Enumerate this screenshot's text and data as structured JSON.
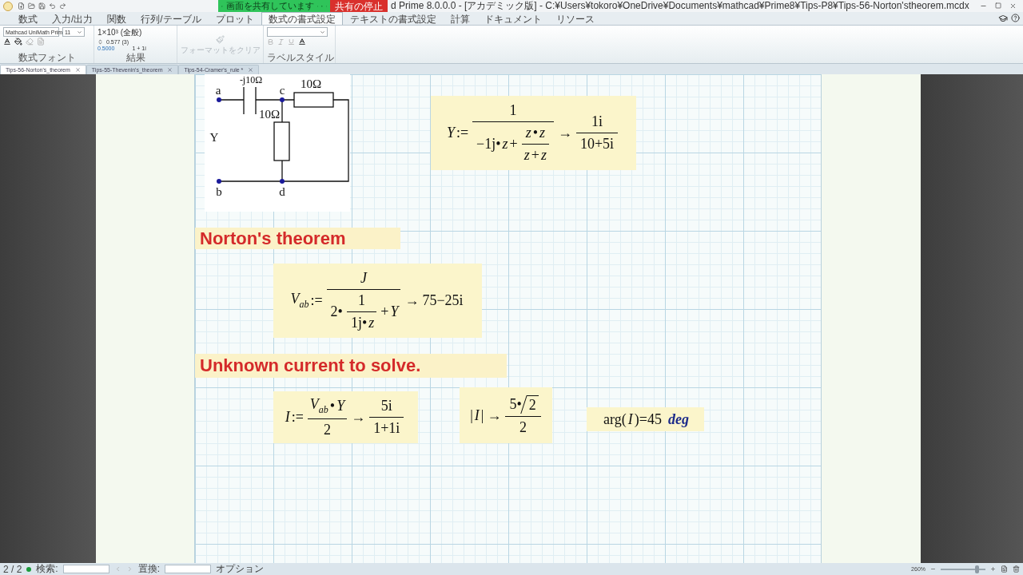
{
  "title_bar": {
    "share_banner": "画面を共有しています",
    "stop_button": "共有の停止",
    "title": "d Prime 8.0.0.0 - [アカデミック版] - C:¥Users¥tokoro¥OneDrive¥Documents¥mathcad¥Prime8¥Tips-P8¥Tips-56-Norton'stheorem.mcdx"
  },
  "ribbon_tabs": [
    {
      "label": "数式",
      "selected": false
    },
    {
      "label": "入力/出力",
      "selected": false
    },
    {
      "label": "関数",
      "selected": false
    },
    {
      "label": "行列/テーブル",
      "selected": false
    },
    {
      "label": "プロット",
      "selected": false
    },
    {
      "label": "数式の書式設定",
      "selected": true
    },
    {
      "label": "テキストの書式設定",
      "selected": false
    },
    {
      "label": "計算",
      "selected": false
    },
    {
      "label": "ドキュメント",
      "selected": false
    },
    {
      "label": "リソース",
      "selected": false
    }
  ],
  "ribbon": {
    "font": "Mathcad UniMath Prim",
    "size": "11",
    "format": "1×10³ (全般)",
    "precision": "0.577 (3)",
    "threshold": "0.5000",
    "complex": "1 + 1i",
    "clear_format": {
      "label": "フォーマットをクリア",
      "disabled": true
    },
    "groups": [
      "数式フォント",
      "結果",
      "ラベルスタイル"
    ]
  },
  "document_tabs": [
    {
      "label": "Tips-56-Norton's_theorem",
      "selected": true
    },
    {
      "label": "Tips-55-Thevenin's_theorem",
      "selected": false
    },
    {
      "label": "Tips-54-Cramer's_rule *",
      "selected": false
    }
  ],
  "circuit": {
    "labels": [
      "-j10Ω",
      "10Ω",
      "a",
      "c",
      "10Ω",
      "Y",
      "b",
      "d"
    ]
  },
  "regions": [
    {
      "kind": "equation",
      "tokens": [
        {
          "v": "Y"
        },
        ":=",
        {
          "frac": [
            [
              "1"
            ],
            [
              "−1j•",
              {
                "v": "z"
              },
              "+",
              {
                "frac": [
                  [
                    {
                      "v": "z"
                    },
                    "•",
                    {
                      "v": "z"
                    }
                  ],
                  [
                    {
                      "v": "z"
                    },
                    "+",
                    {
                      "v": "z"
                    }
                  ]
                ]
              }
            ]
          ]
        },
        "→",
        {
          "frac": [
            [
              "1i"
            ],
            [
              "10+5i"
            ]
          ]
        }
      ]
    },
    {
      "kind": "heading",
      "text": "Norton's theorem"
    },
    {
      "kind": "equation",
      "tokens": [
        {
          "v": "V",
          "sub": "ab"
        },
        ":=",
        {
          "frac": [
            [
              {
                "v": "J"
              }
            ],
            [
              "2•",
              {
                "frac": [
                  [
                    "1"
                  ],
                  [
                    "1j•",
                    {
                      "v": "z"
                    }
                  ]
                ]
              },
              "+",
              {
                "v": "Y"
              }
            ]
          ]
        },
        "→",
        "75−25i"
      ]
    },
    {
      "kind": "heading",
      "text": "Unknown current to solve."
    },
    {
      "kind": "equation",
      "tokens": [
        {
          "v": "I"
        },
        ":=",
        {
          "frac": [
            [
              {
                "v": "V",
                "sub": "ab"
              },
              "•",
              {
                "v": "Y"
              }
            ],
            [
              "2"
            ]
          ]
        },
        "→",
        {
          "frac": [
            [
              "5i"
            ],
            [
              "1+1i"
            ]
          ]
        }
      ]
    },
    {
      "kind": "equation",
      "tokens": [
        "|",
        {
          "v": "I"
        },
        "|",
        "→",
        {
          "frac": [
            [
              "5•",
              {
                "sqrt": [
                  "2"
                ]
              }
            ],
            [
              "2"
            ]
          ]
        }
      ]
    },
    {
      "kind": "equation",
      "tokens": [
        "arg(",
        {
          "v": "I"
        },
        ")=45",
        {
          "unit": "deg"
        }
      ]
    }
  ],
  "status_bar": {
    "page": "2 / 2",
    "search_label": "検索:",
    "replace_label": "置換:",
    "options": "オプション",
    "zoom": "260%",
    "zoom_slider": {
      "level": 0.8
    }
  }
}
